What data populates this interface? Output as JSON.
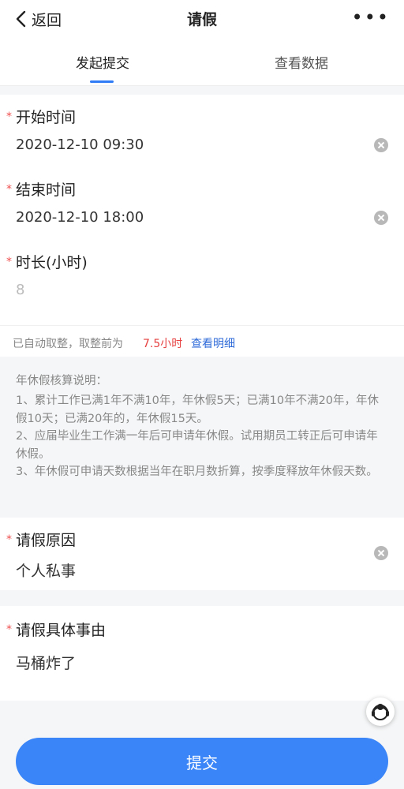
{
  "nav": {
    "back_label": "返回",
    "title": "请假",
    "more_label": "•••"
  },
  "tabs": [
    {
      "label": "发起提交",
      "active": true
    },
    {
      "label": "查看数据",
      "active": false
    }
  ],
  "form": {
    "start_time": {
      "label": "开始时间",
      "value": "2020-12-10 09:30",
      "required": true
    },
    "end_time": {
      "label": "结束时间",
      "value": "2020-12-10 18:00",
      "required": true
    },
    "duration": {
      "label": "时长(小时)",
      "value": "8",
      "required": true
    }
  },
  "rounding_tip": {
    "text": "已自动取整，取整前为",
    "hours": "7.5小时",
    "link": "查看明细"
  },
  "annual_leave_note": {
    "title": "年休假核算说明：",
    "lines": [
      "1、累计工作已满1年不满10年，年休假5天；已满10年不满20年，年休假10天；已满20年的，年休假15天。",
      "2、应届毕业生工作满一年后可申请年休假。试用期员工转正后可申请年休假。",
      "3、年休假可申请天数根据当年在职月数折算，按季度释放年休假天数。"
    ]
  },
  "reason": {
    "label": "请假原因",
    "value": "个人私事",
    "required": true
  },
  "detail": {
    "label": "请假具体事由",
    "value": "马桶炸了",
    "required": true
  },
  "required_mark": "*",
  "submit_label": "提交",
  "colors": {
    "accent": "#3a85f7",
    "required": "#f05050",
    "highlight": "#e64040",
    "link": "#2f6bd8"
  }
}
